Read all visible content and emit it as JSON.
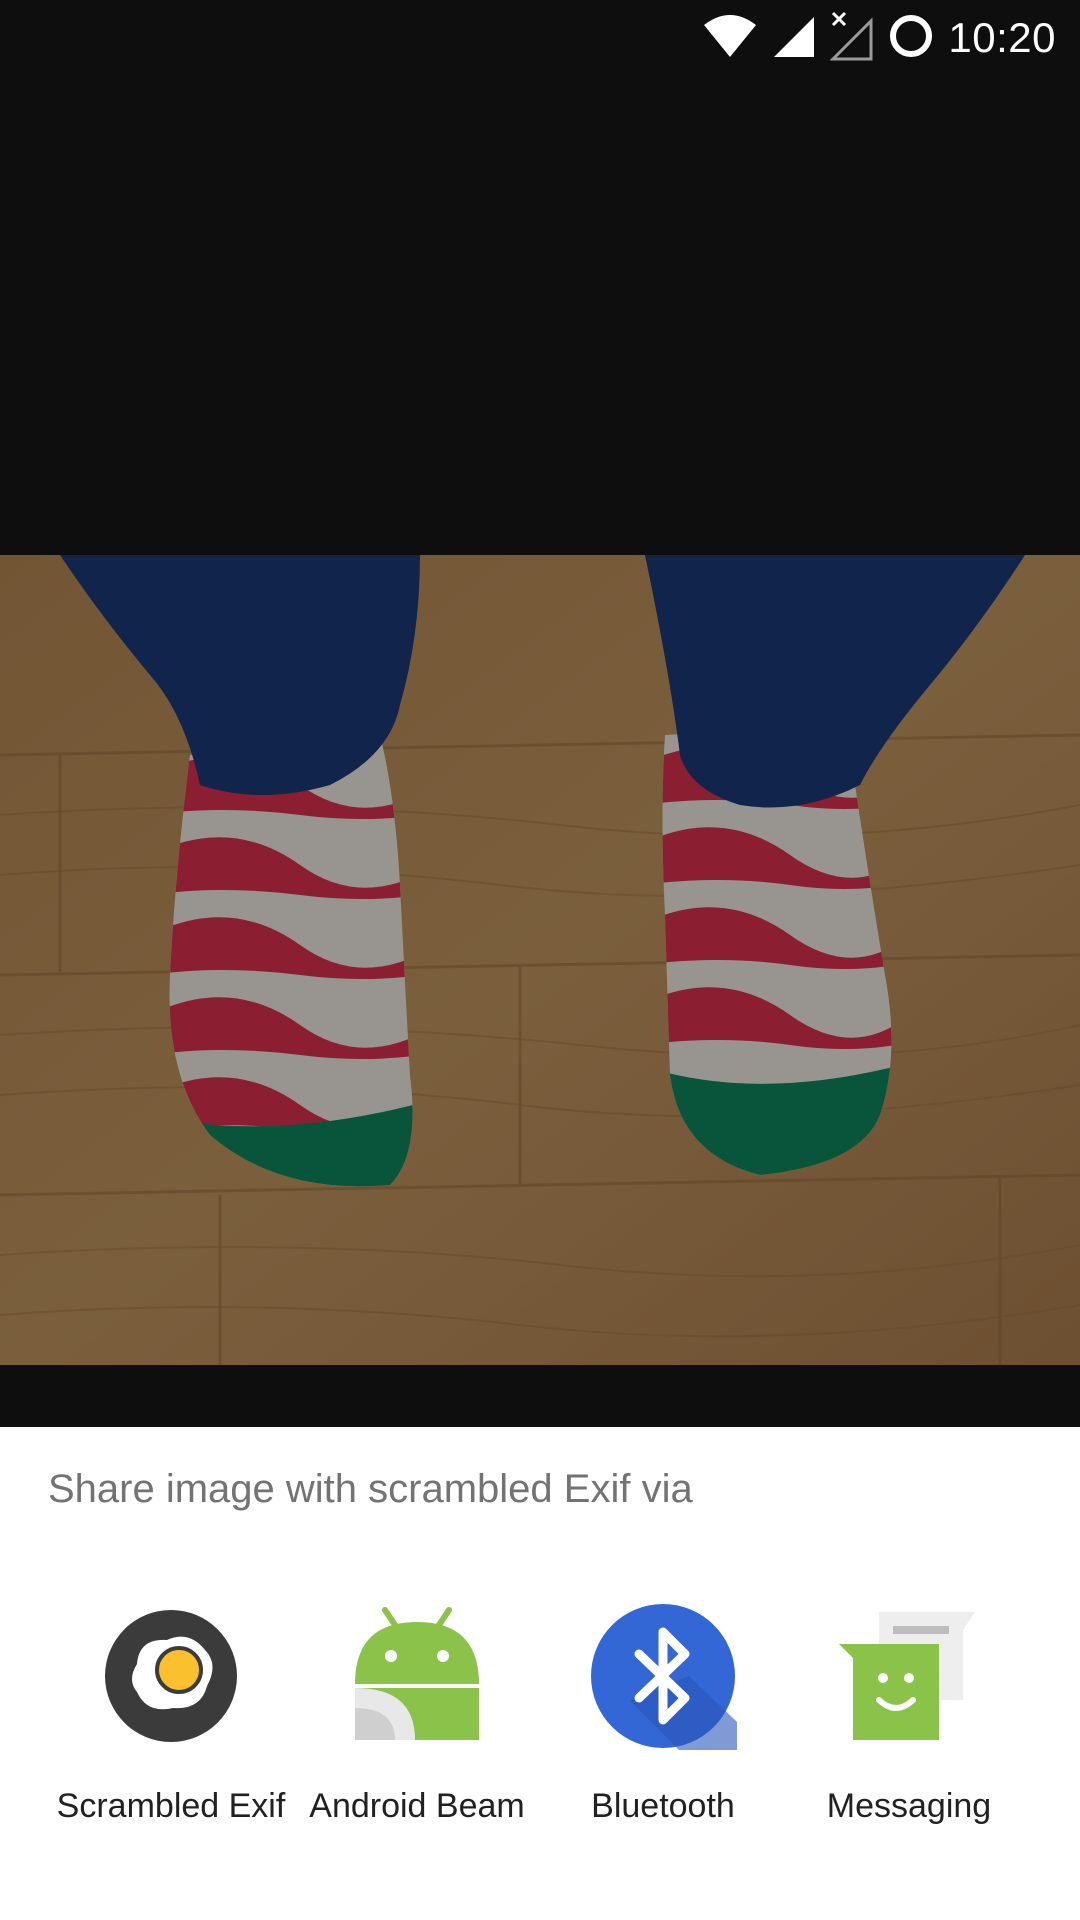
{
  "status_bar": {
    "time": "10:20",
    "icons": [
      "wifi-icon",
      "signal-icon",
      "no-sim-signal-icon",
      "battery-ring-icon"
    ]
  },
  "photo": {
    "icon": "photo-preview"
  },
  "share_sheet": {
    "title": "Share image with scrambled Exif via",
    "targets": [
      {
        "label": "Scrambled Exif",
        "icon": "fried-egg-icon"
      },
      {
        "label": "Android Beam",
        "icon": "android-beam-icon"
      },
      {
        "label": "Bluetooth",
        "icon": "bluetooth-icon"
      },
      {
        "label": "Messaging",
        "icon": "messaging-icon"
      }
    ]
  },
  "colors": {
    "background": "#0e0e0f",
    "sheet": "#ffffff",
    "title_text": "#737373",
    "label_text": "#212121",
    "bluetooth_blue": "#3367d6",
    "android_green": "#8bc34a"
  }
}
